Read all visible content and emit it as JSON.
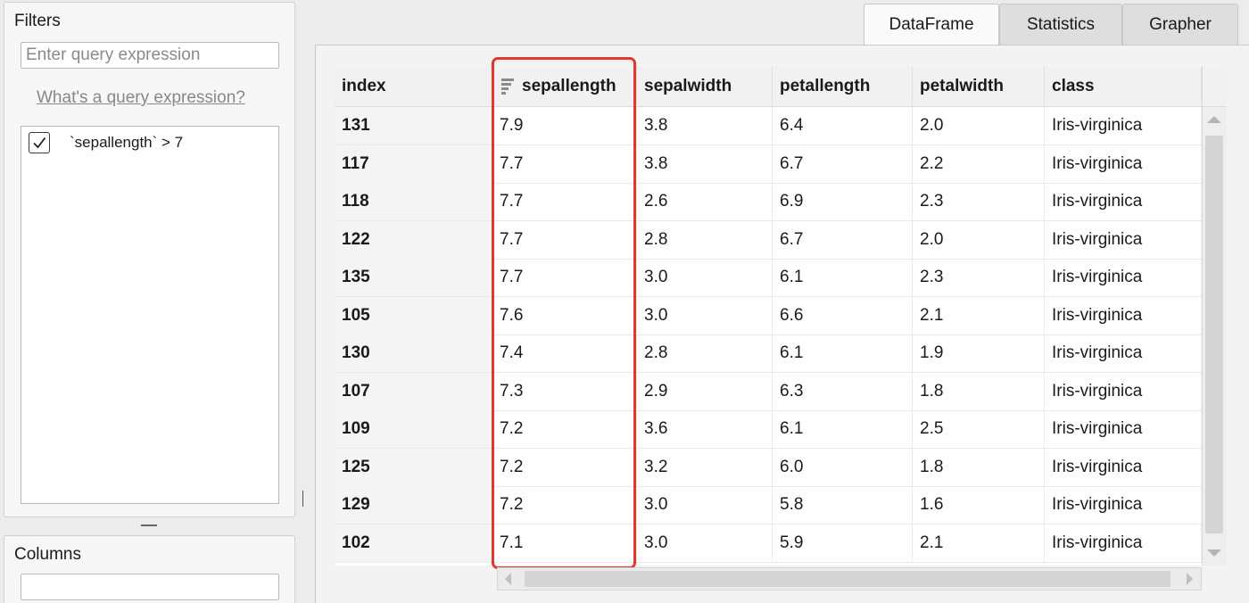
{
  "filters": {
    "title": "Filters",
    "query_placeholder": "Enter query expression",
    "help_link": "What's a query expression?",
    "items": [
      {
        "expression": "`sepallength` > 7",
        "checked": true
      }
    ]
  },
  "columns_panel": {
    "title": "Columns"
  },
  "tabs": [
    {
      "label": "DataFrame",
      "active": true
    },
    {
      "label": "Statistics",
      "active": false
    },
    {
      "label": "Grapher",
      "active": false
    }
  ],
  "table": {
    "sorted_column": "sepallength",
    "columns": [
      "index",
      "sepallength",
      "sepalwidth",
      "petallength",
      "petalwidth",
      "class"
    ],
    "rows": [
      [
        "131",
        "7.9",
        "3.8",
        "6.4",
        "2.0",
        "Iris-virginica"
      ],
      [
        "117",
        "7.7",
        "3.8",
        "6.7",
        "2.2",
        "Iris-virginica"
      ],
      [
        "118",
        "7.7",
        "2.6",
        "6.9",
        "2.3",
        "Iris-virginica"
      ],
      [
        "122",
        "7.7",
        "2.8",
        "6.7",
        "2.0",
        "Iris-virginica"
      ],
      [
        "135",
        "7.7",
        "3.0",
        "6.1",
        "2.3",
        "Iris-virginica"
      ],
      [
        "105",
        "7.6",
        "3.0",
        "6.6",
        "2.1",
        "Iris-virginica"
      ],
      [
        "130",
        "7.4",
        "2.8",
        "6.1",
        "1.9",
        "Iris-virginica"
      ],
      [
        "107",
        "7.3",
        "2.9",
        "6.3",
        "1.8",
        "Iris-virginica"
      ],
      [
        "109",
        "7.2",
        "3.6",
        "6.1",
        "2.5",
        "Iris-virginica"
      ],
      [
        "125",
        "7.2",
        "3.2",
        "6.0",
        "1.8",
        "Iris-virginica"
      ],
      [
        "129",
        "7.2",
        "3.0",
        "5.8",
        "1.6",
        "Iris-virginica"
      ],
      [
        "102",
        "7.1",
        "3.0",
        "5.9",
        "2.1",
        "Iris-virginica"
      ]
    ]
  },
  "highlight_color": "#e03a2f"
}
